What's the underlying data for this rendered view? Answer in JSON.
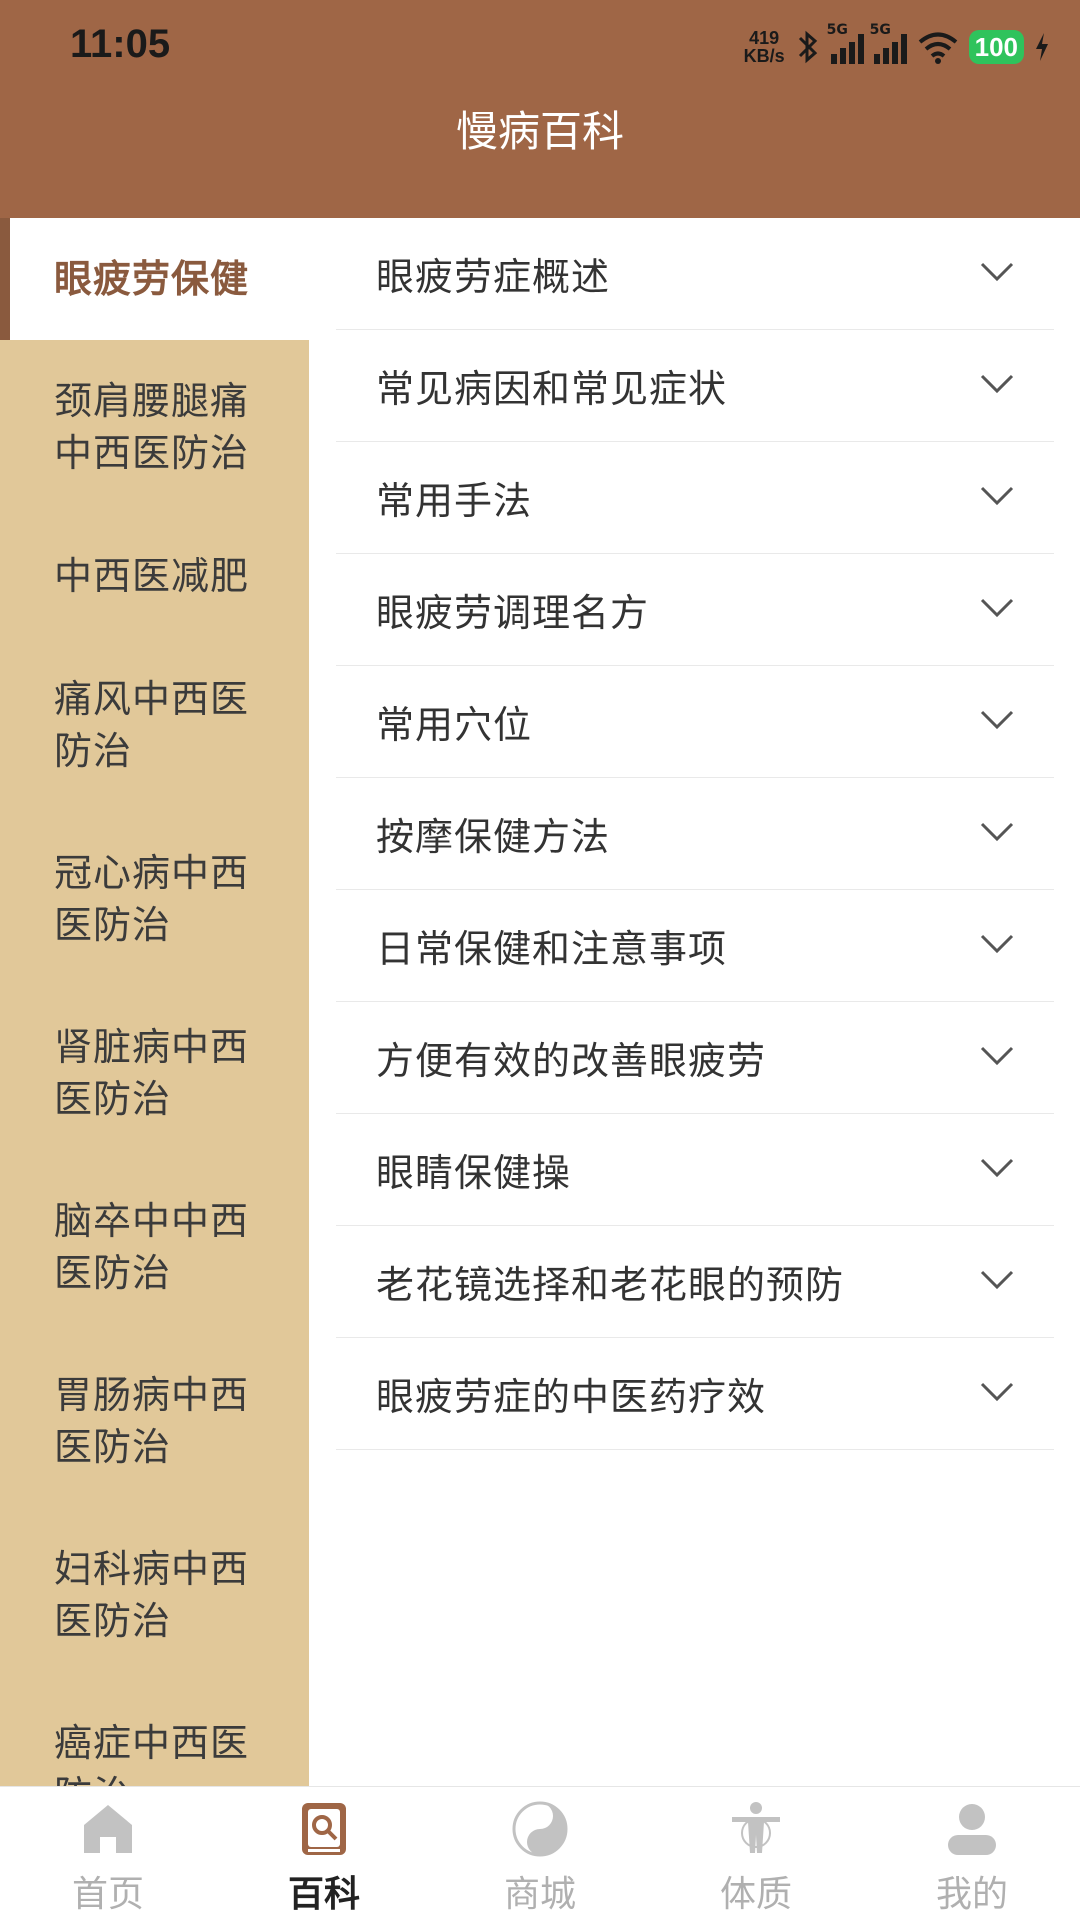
{
  "status_bar": {
    "time": "11:05",
    "net_speed_value": "419",
    "net_speed_unit": "KB/s",
    "signal_1_label": "5G",
    "signal_2_label": "5G",
    "battery": "100"
  },
  "header": {
    "title": "慢病百科"
  },
  "sidebar": {
    "items": [
      {
        "label": "眼疲劳保健",
        "active": true
      },
      {
        "label": "颈肩腰腿痛中西医防治"
      },
      {
        "label": "中西医减肥"
      },
      {
        "label": "痛风中西医防治"
      },
      {
        "label": "冠心病中西医防治"
      },
      {
        "label": "肾脏病中西医防治"
      },
      {
        "label": "脑卒中中西医防治"
      },
      {
        "label": "胃肠病中西医防治"
      },
      {
        "label": "妇科病中西医防治"
      },
      {
        "label": "癌症中西医防治"
      }
    ]
  },
  "content": {
    "rows": [
      {
        "label": "眼疲劳症概述"
      },
      {
        "label": "常见病因和常见症状"
      },
      {
        "label": "常用手法"
      },
      {
        "label": "眼疲劳调理名方"
      },
      {
        "label": "常用穴位"
      },
      {
        "label": "按摩保健方法"
      },
      {
        "label": "日常保健和注意事项"
      },
      {
        "label": "方便有效的改善眼疲劳"
      },
      {
        "label": "眼睛保健操"
      },
      {
        "label": "老花镜选择和老花眼的预防"
      },
      {
        "label": "眼疲劳症的中医药疗效"
      }
    ]
  },
  "tabbar": {
    "tabs": [
      {
        "label": "首页",
        "icon": "home-icon"
      },
      {
        "label": "百科",
        "icon": "encyclopedia-icon",
        "active": true
      },
      {
        "label": "商城",
        "icon": "yin-yang-icon"
      },
      {
        "label": "体质",
        "icon": "body-icon"
      },
      {
        "label": "我的",
        "icon": "profile-icon"
      }
    ]
  },
  "colors": {
    "header": "#9f6646",
    "sidebar": "#e1c899",
    "accent": "#8a5a3e",
    "battery": "#2fc35c"
  }
}
